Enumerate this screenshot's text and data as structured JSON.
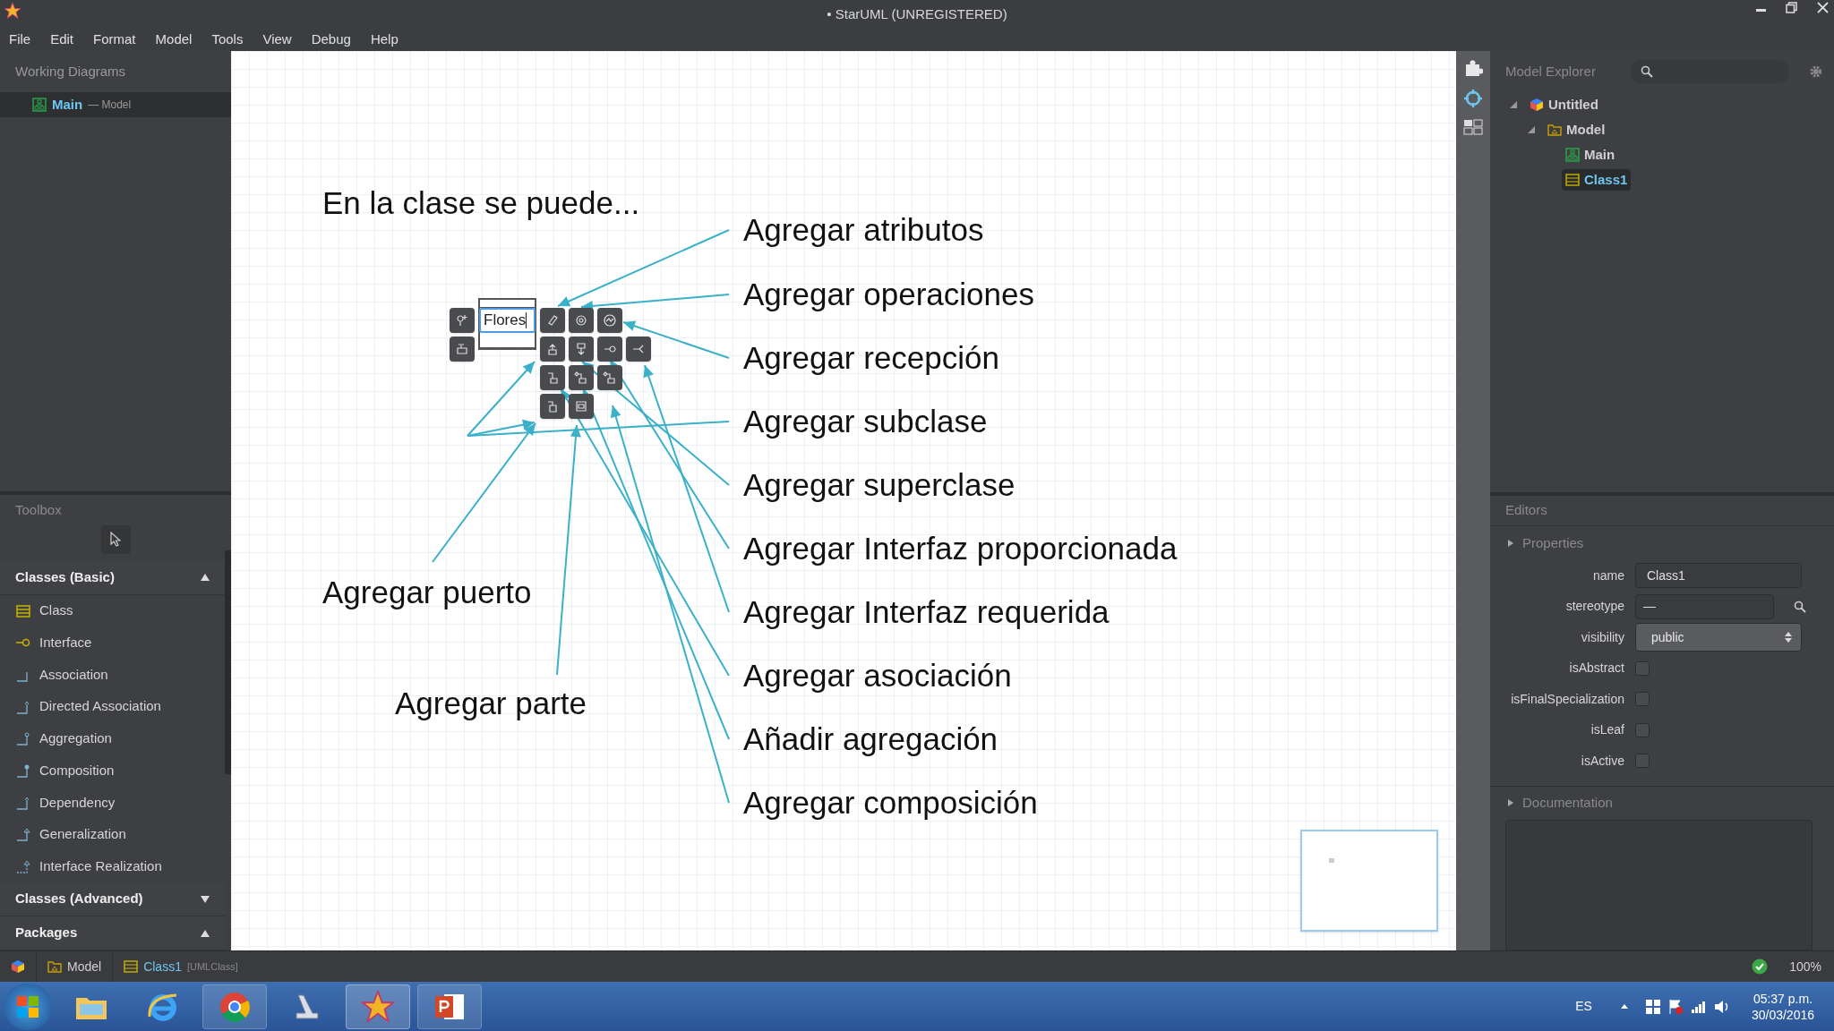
{
  "window": {
    "title": "• StarUML (UNREGISTERED)"
  },
  "menu": [
    "File",
    "Edit",
    "Format",
    "Model",
    "Tools",
    "View",
    "Debug",
    "Help"
  ],
  "working_diagrams": {
    "title": "Working Diagrams",
    "items": [
      {
        "name": "Main",
        "owner": "— Model",
        "selected": true
      }
    ]
  },
  "toolbox": {
    "title": "Toolbox",
    "groups": [
      {
        "title": "Classes (Basic)",
        "expanded": true,
        "items": [
          "Class",
          "Interface",
          "Association",
          "Directed Association",
          "Aggregation",
          "Composition",
          "Dependency",
          "Generalization",
          "Interface Realization"
        ]
      },
      {
        "title": "Classes (Advanced)",
        "expanded": false
      },
      {
        "title": "Packages",
        "expanded": true
      }
    ]
  },
  "diagram": {
    "heading": "En la clase se puede...",
    "class_name": "Flores",
    "annotations": [
      "Agregar atributos",
      "Agregar operaciones",
      "Agregar recepción",
      "Agregar subclase",
      "Agregar superclase",
      "Agregar Interfaz proporcionada",
      "Agregar Interfaz requerida",
      "Agregar asociación",
      "Añadir agregación",
      "Agregar composición"
    ],
    "side_annotations": [
      "Agregar puerto",
      "Agregar parte"
    ]
  },
  "model_explorer": {
    "title": "Model Explorer",
    "tree": [
      {
        "label": "Untitled",
        "kind": "project",
        "selected": false,
        "expanded": true,
        "children": [
          {
            "label": "Model",
            "kind": "model",
            "selected": false,
            "expanded": true,
            "children": [
              {
                "label": "Main",
                "kind": "diagram",
                "selected": false
              },
              {
                "label": "Class1",
                "kind": "class",
                "selected": true
              }
            ]
          }
        ]
      }
    ]
  },
  "editors": {
    "title": "Editors",
    "properties_title": "Properties",
    "fields": [
      {
        "kind": "text",
        "label": "name",
        "value": "Class1"
      },
      {
        "kind": "search",
        "label": "stereotype",
        "value": "—"
      },
      {
        "kind": "select",
        "label": "visibility",
        "value": "public"
      },
      {
        "kind": "checkbox",
        "label": "isAbstract",
        "checked": false
      },
      {
        "kind": "checkbox",
        "label": "isFinalSpecialization",
        "checked": false
      },
      {
        "kind": "checkbox",
        "label": "isLeaf",
        "checked": false
      },
      {
        "kind": "checkbox",
        "label": "isActive",
        "checked": false
      }
    ],
    "documentation_title": "Documentation"
  },
  "status_bar": {
    "items": [
      {
        "kind": "model",
        "label": "Model"
      },
      {
        "kind": "class",
        "label": "Class1",
        "type": "[UMLClass]"
      }
    ],
    "zoom": "100%"
  },
  "taskbar": {
    "language": "ES",
    "time": "05:37 p.m.",
    "date": "30/03/2016"
  }
}
